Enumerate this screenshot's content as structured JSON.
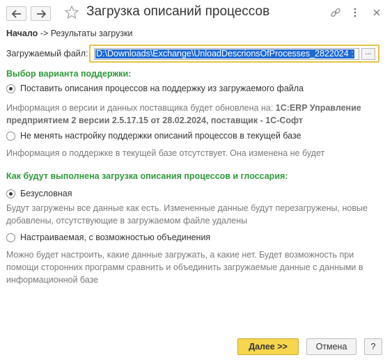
{
  "window": {
    "title": "Загрузка описаний процессов",
    "icons": [
      "back-arrow-icon",
      "forward-arrow-icon",
      "star-icon",
      "link-icon",
      "more-vertical-icon",
      "close-icon"
    ]
  },
  "breadcrumb": {
    "current": "Начало",
    "separator": "->",
    "next": "Результаты загрузки"
  },
  "file": {
    "label": "Загружаемый файл:",
    "value": "D:\\Downloads\\Exchange\\UnloadDescrionsOfProcesses_2822024 :",
    "browse_label": "..."
  },
  "support": {
    "heading": "Выбор варианта поддержки:",
    "option1_label": "Поставить описания процессов на поддержку из загружаемого файла",
    "option1_selected": true,
    "option1_hint_prefix": "Информация о версии и данных поставщика будет обновлена на:",
    "option1_hint_line1_bold": "1С:ERP Управление",
    "option1_hint_line2_bold": "предприятием 2 версии 2.5.17.15 от 28.02.2024, поставщик - 1С-Софт",
    "option2_label": "Не менять настройку поддержки описаний процессов в текущей базе",
    "option2_selected": false,
    "option2_hint": "Информация о поддержке в текущей базе отсутствует. Она изменена не будет"
  },
  "load": {
    "heading": "Как будут выполнена загрузка описания процессов и глоссария:",
    "option1_label": "Безусловная",
    "option1_selected": true,
    "option1_hint_line1": "Будут загружены все данные как есть. Измененные данные будут перезагружены, новые",
    "option1_hint_line2": "добавлены, отсутствующие в загружаемом файле удалены",
    "option2_label": "Настраиваемая, с возможностью объединения",
    "option2_selected": false,
    "option2_hint_line1": "Можно будет настроить, какие данные загружать, а какие нет. Будет возможность при",
    "option2_hint_line2": "помощи сторонних программ сравнить и объединить загружаемые данные с данными в",
    "option2_hint_line3": "информационной базе"
  },
  "footer": {
    "next_label": "Далее >>",
    "cancel_label": "Отмена",
    "help_label": "?"
  },
  "colors": {
    "accent_green": "#2e9a3a",
    "primary_button": "#f7d64f",
    "focus_border": "#e3c445",
    "selection": "#1e69d3"
  }
}
